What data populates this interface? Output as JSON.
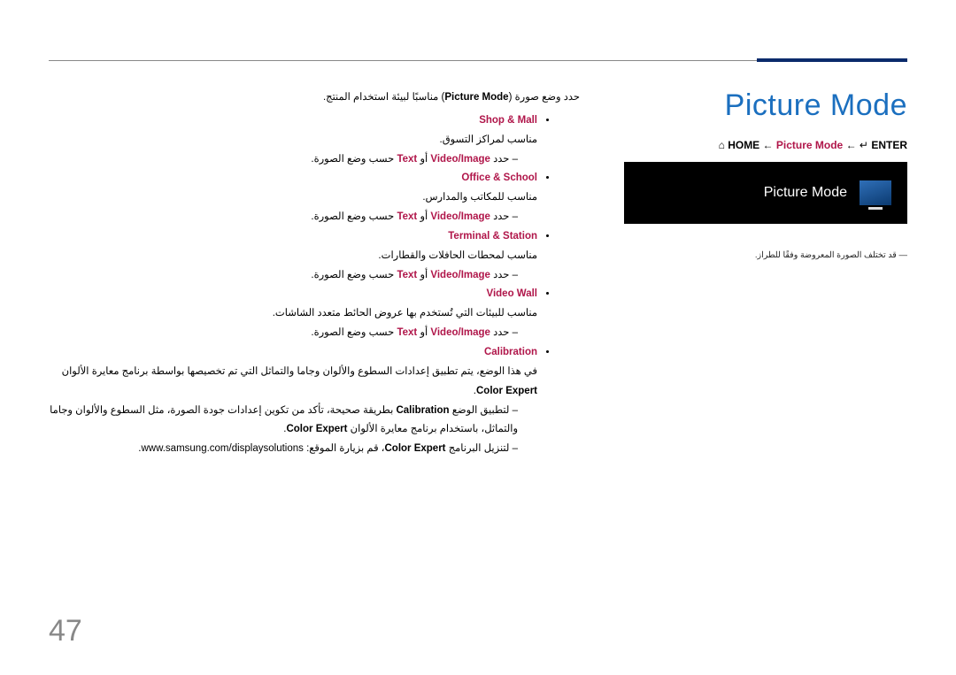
{
  "page_number": "47",
  "title": "Picture Mode",
  "breadcrumb": {
    "home_sym": "⌂",
    "home_label": "HOME",
    "arrow": "←",
    "middle": "Picture Mode",
    "enter_sym": "↵",
    "enter_label": "ENTER"
  },
  "screenshot": {
    "label": "Picture Mode"
  },
  "right_note": "قد تختلف الصورة المعروضة وفقًا للطراز.",
  "intro": {
    "pre": "حدد وضع صورة (",
    "mid": "Picture Mode",
    "post": ") مناسبًا لبيئة استخدام المنتج."
  },
  "modes": {
    "shop": {
      "name": "Shop & Mall",
      "desc": "مناسب لمراكز التسوق.",
      "select_pre": "حدد ",
      "opt1": "Video/Image",
      "or": " أو ",
      "opt2": "Text",
      "select_post": " حسب وضع الصورة."
    },
    "office": {
      "name": "Office & School",
      "desc": "مناسب للمكاتب والمدارس.",
      "select_pre": "حدد ",
      "opt1": "Video/Image",
      "or": " أو ",
      "opt2": "Text",
      "select_post": " حسب وضع الصورة."
    },
    "terminal": {
      "name": "Terminal & Station",
      "desc": "مناسب لمحطات الحافلات والقطارات.",
      "select_pre": "حدد ",
      "opt1": "Video/Image",
      "or": " أو ",
      "opt2": "Text",
      "select_post": " حسب وضع الصورة."
    },
    "videowall": {
      "name": "Video Wall",
      "desc": "مناسب للبيئات التي تُستخدم بها عروض الحائط متعدد الشاشات.",
      "select_pre": "حدد ",
      "opt1": "Video/Image",
      "or": " أو ",
      "opt2": "Text",
      "select_post": " حسب وضع الصورة."
    },
    "calibration": {
      "name": "Calibration",
      "desc_pre": "في هذا الوضع، يتم تطبيق إعدادات السطوع والألوان وجاما والتماثل التي تم تخصيصها بواسطة برنامج معايرة الألوان ",
      "desc_ce": "Color Expert",
      "desc_post": ".",
      "line2_pre": "لتطبيق الوضع ",
      "line2_cal": "Calibration",
      "line2_mid": " بطريقة صحيحة، تأكد من تكوين إعدادات جودة الصورة، مثل السطوع والألوان وجاما والتماثل، باستخدام برنامج معايرة الألوان ",
      "line2_ce": "Color Expert",
      "line2_post": ".",
      "line3_pre": "لتنزيل البرنامج ",
      "line3_ce": "Color Expert",
      "line3_mid": "، قم بزيارة الموقع: ",
      "line3_url": "www.samsung.com/displaysolutions",
      "line3_post": "."
    }
  }
}
